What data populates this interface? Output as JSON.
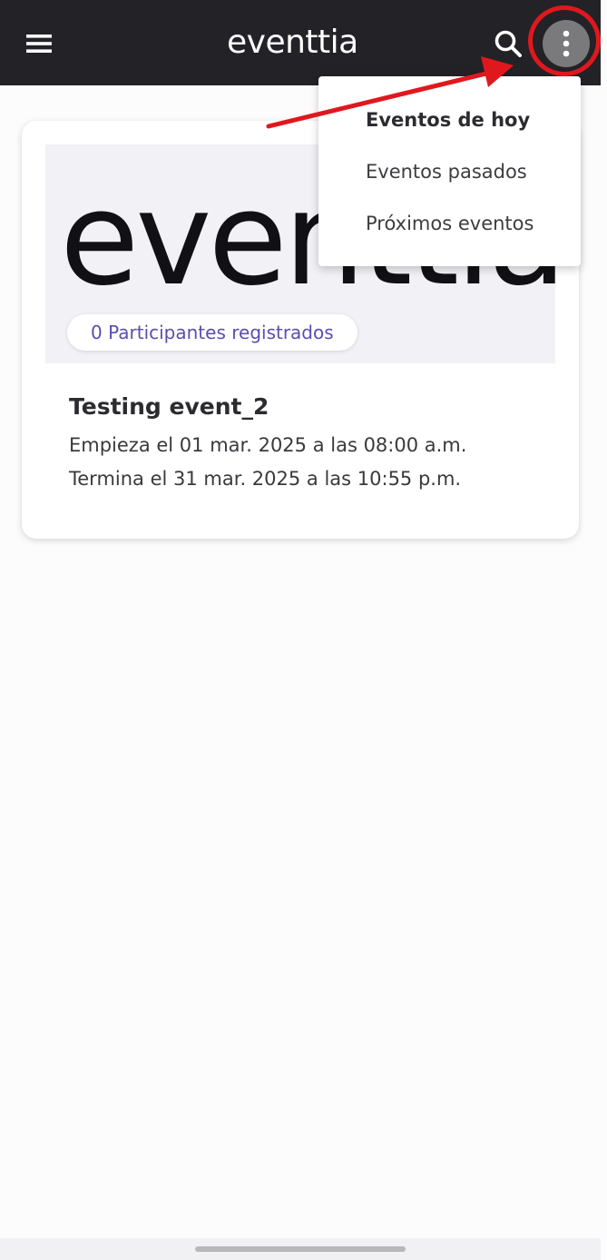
{
  "app": {
    "brand": "eventtia"
  },
  "header": {
    "menu_icon": "hamburger-menu-icon",
    "search_icon": "search-icon",
    "more_icon": "more-vertical-icon"
  },
  "event_card": {
    "banner_logo": "eventtia",
    "participants_badge": "0 Participantes registrados",
    "title": "Testing event_2",
    "starts": "Empieza el 01 mar. 2025 a las 08:00 a.m.",
    "ends": "Termina el 31 mar. 2025 a las 10:55 p.m."
  },
  "dropdown_menu": {
    "items": [
      {
        "label": "Eventos de hoy",
        "active": true
      },
      {
        "label": "Eventos pasados",
        "active": false
      },
      {
        "label": "Próximos eventos",
        "active": false
      }
    ]
  },
  "colors": {
    "appbar": "#232227",
    "accent_text": "#5a4eae",
    "annotation": "#e0181d"
  }
}
